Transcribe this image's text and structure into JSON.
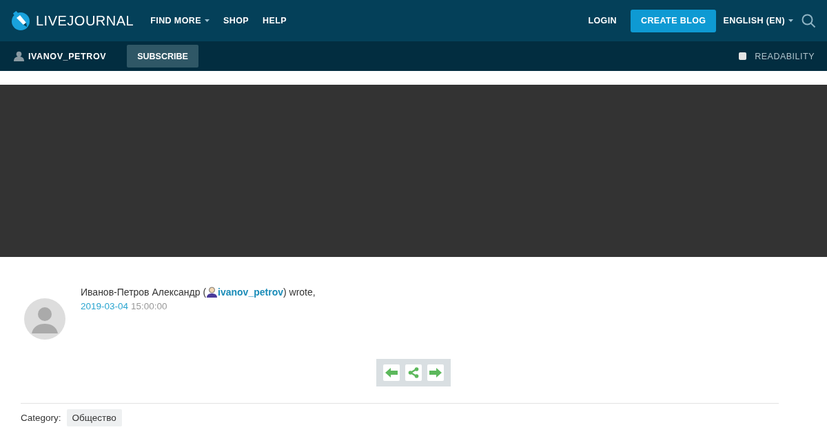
{
  "header": {
    "logo": "LIVEJOURNAL",
    "nav": [
      {
        "label": "FIND MORE",
        "dropdown": true
      },
      {
        "label": "SHOP",
        "dropdown": false
      },
      {
        "label": "HELP",
        "dropdown": false
      }
    ],
    "login": "LOGIN",
    "create_blog": "CREATE BLOG",
    "language": "ENGLISH (EN)"
  },
  "subbar": {
    "username": "IVANOV_PETROV",
    "subscribe": "SUBSCRIBE",
    "readability": {
      "label": "READABILITY",
      "checked": false
    }
  },
  "post": {
    "author_name": "Иванов-Петров Александр (",
    "user_link": "ivanov_petrov",
    "wrote": ") wrote,",
    "date": "2019-03-04",
    "time": "15:00:00"
  },
  "category": {
    "label": "Category:",
    "tag": "Общество"
  }
}
